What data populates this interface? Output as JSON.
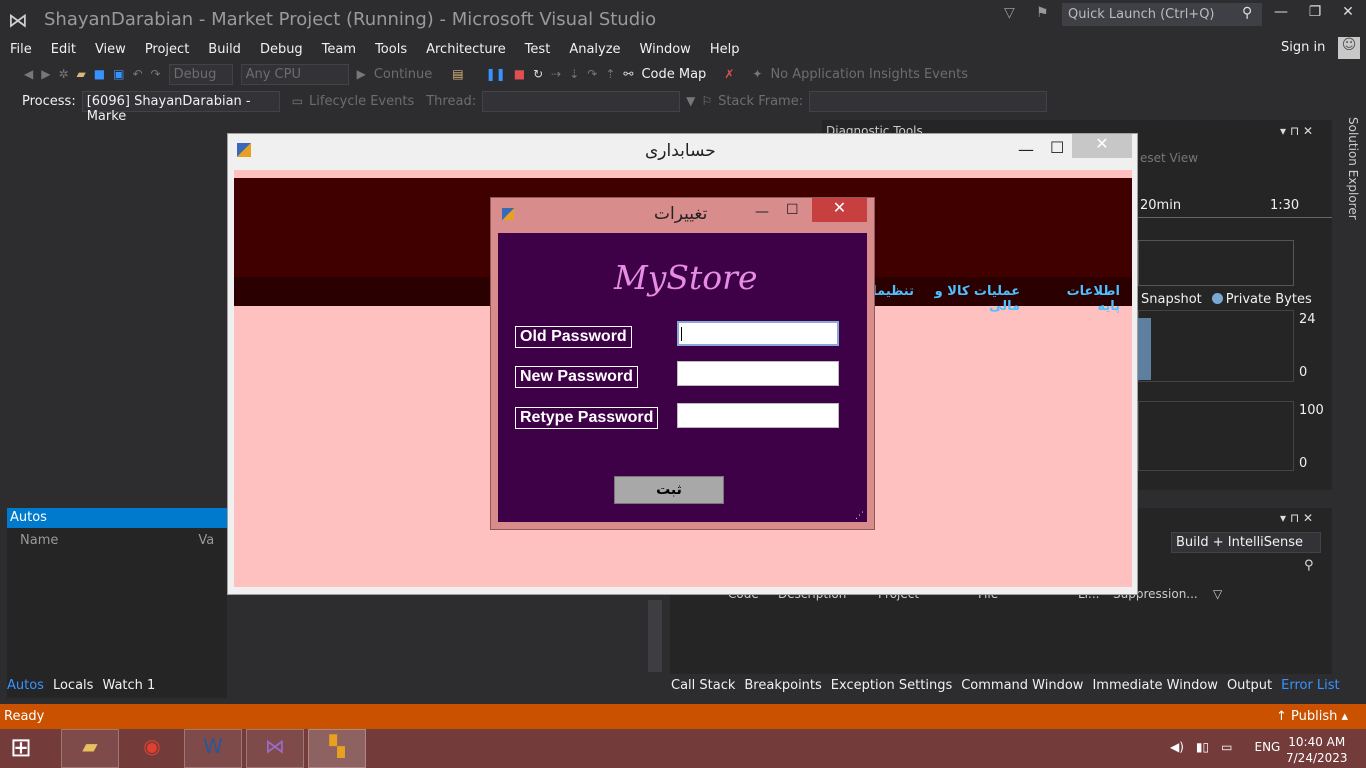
{
  "app_title": "ShayanDarabian - Market Project (Running) - Microsoft Visual Studio",
  "quick_launch": "Quick Launch (Ctrl+Q)",
  "menu": [
    "File",
    "Edit",
    "View",
    "Project",
    "Build",
    "Debug",
    "Team",
    "Tools",
    "Architecture",
    "Test",
    "Analyze",
    "Window",
    "Help"
  ],
  "sign_in": "Sign in",
  "toolbar": {
    "config": "Debug",
    "platform": "Any CPU",
    "continue": "Continue",
    "code_map": "Code Map",
    "insights": "No Application Insights Events"
  },
  "toolbar2": {
    "process_label": "Process:",
    "process_value": "[6096] ShayanDarabian - Marke",
    "lifecycle": "Lifecycle Events",
    "thread_label": "Thread:",
    "stack_frame_label": "Stack Frame:"
  },
  "diagnostics": {
    "title": "Diagnostic Tools",
    "reset_view": "eset View",
    "time_20": "20min",
    "time_130": "1:30",
    "legend_snapshot": "Snapshot",
    "legend_private": "Private Bytes",
    "y1_top": "24",
    "y1_bottom": "0",
    "y2_top": "100",
    "y2_bottom": "0"
  },
  "autos": {
    "title": "Autos",
    "col_name": "Name",
    "col_value": "Va"
  },
  "error_list": {
    "filter": "Build + IntelliSense",
    "col_code": "Code",
    "col_description": "Description",
    "col_project": "Project",
    "col_file": "File",
    "col_line": "Li...",
    "col_suppression": "Suppression..."
  },
  "bottom_left_tabs": [
    "Autos",
    "Locals",
    "Watch 1"
  ],
  "bottom_right_tabs": [
    "Call Stack",
    "Breakpoints",
    "Exception Settings",
    "Command Window",
    "Immediate Window",
    "Output",
    "Error List"
  ],
  "solution_explorer": "Solution Explorer",
  "status": {
    "text": "Ready",
    "publish": "Publish"
  },
  "clock": {
    "time": "10:40 AM",
    "date": "7/24/2023",
    "lang": "ENG"
  },
  "accounting_window": {
    "title": "حسابداری",
    "menu": [
      "اطلاعات پایه",
      "عملیات کالا و مالی",
      "تنظیمات"
    ]
  },
  "change_dialog": {
    "title": "تغییرات",
    "store_name": "MyStore",
    "old_password_label": "Old Password",
    "new_password_label": "New Password",
    "retype_password_label": "Retype Password",
    "submit_label": "ثبت"
  },
  "colors": {
    "status_bar": "#ca5100",
    "dialog_body": "#3e0046",
    "accounting_body": "#ffc0c0",
    "header_strip": "#400000"
  }
}
